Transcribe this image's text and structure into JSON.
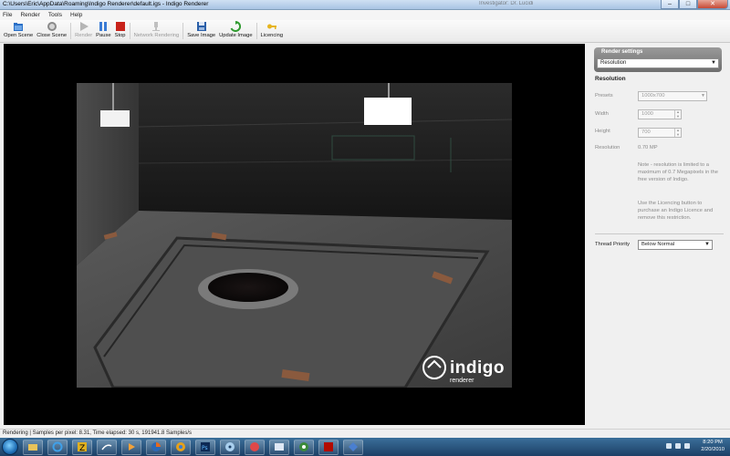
{
  "window": {
    "title": "C:\\Users\\Eric\\AppData\\Roaming\\Indigo Renderer\\default.igs - Indigo Renderer",
    "ghost_title": "Investigator: Dr. Lucidi",
    "minimize": "–",
    "maximize": "□",
    "close": "✕"
  },
  "menu": {
    "items": [
      "File",
      "Render",
      "Tools",
      "Help"
    ]
  },
  "toolbar": {
    "buttons": [
      {
        "label": "Open Scene",
        "icon": "folder-open-icon",
        "enabled": true
      },
      {
        "label": "Close Scene",
        "icon": "close-scene-icon",
        "enabled": true
      },
      {
        "label": "Render",
        "icon": "play-icon",
        "enabled": false
      },
      {
        "label": "Pause",
        "icon": "pause-icon",
        "enabled": true
      },
      {
        "label": "Stop",
        "icon": "stop-icon",
        "enabled": true
      },
      {
        "label": "Network Rendering",
        "icon": "network-icon",
        "enabled": false
      },
      {
        "label": "Save Image",
        "icon": "save-icon",
        "enabled": true
      },
      {
        "label": "Update Image",
        "icon": "update-icon",
        "enabled": true
      },
      {
        "label": "Licencing",
        "icon": "key-icon",
        "enabled": true
      }
    ]
  },
  "render_view": {
    "watermark_brand": "indigo",
    "watermark_sub": "renderer"
  },
  "side_panel": {
    "header": "Render settings",
    "mode_select": "Resolution",
    "section_title": "Resolution",
    "presets_label": "Presets",
    "presets_value": "1000x700",
    "width_label": "Width",
    "width_value": "1000",
    "height_label": "Height",
    "height_value": "700",
    "resolution_label": "Resolution",
    "resolution_value": "0.70 MP",
    "note1": "Note - resolution is limited to a maximum of 0.7 Megapixels in the free version of Indigo.",
    "note2": "Use the Licencing button to purchase an Indigo Licence and remove this restriction.",
    "thread_priority_label": "Thread Priority",
    "thread_priority_value": "Below Normal"
  },
  "status": {
    "text": "Rendering | Samples per pixel: 8.31, Time elapsed: 30 s, 191941.8 Samples/s"
  },
  "taskbar": {
    "time": "8:20 PM",
    "date": "2/20/2010",
    "apps": [
      "explorer-icon",
      "ie-icon",
      "app-z-icon",
      "paint-icon",
      "media-player-icon",
      "firefox-icon",
      "chrome-icon",
      "photoshop-icon",
      "disc-icon",
      "itunes-icon",
      "window-icon",
      "chrome-2-icon",
      "acrobat-icon",
      "indigo-icon"
    ]
  },
  "colors": {
    "accent": "#1f6fb6",
    "stop_red": "#c8231b",
    "pause_blue": "#3a7bd5",
    "update_green": "#2f9a2f"
  }
}
